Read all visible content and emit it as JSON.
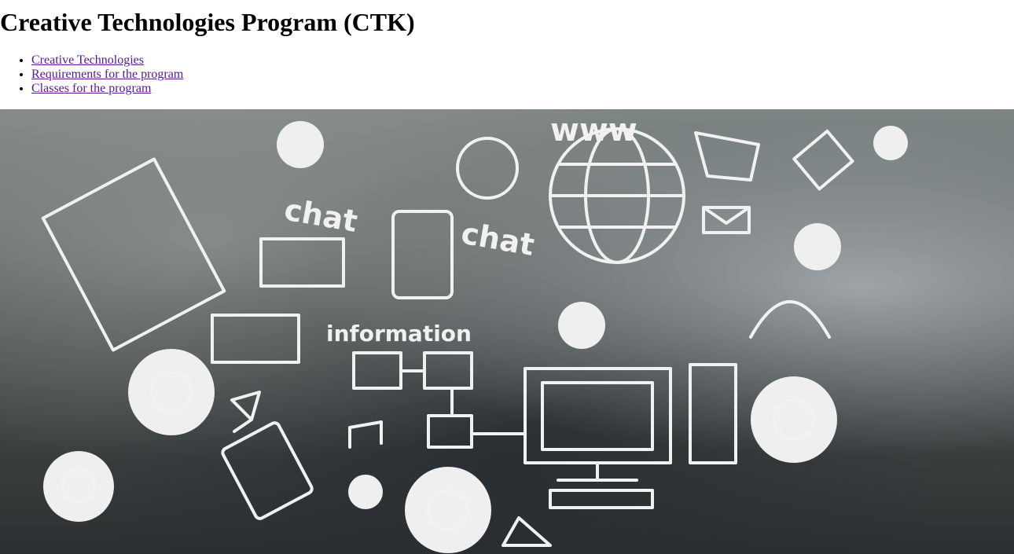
{
  "page": {
    "title": "Creative Technologies Program (CTK)"
  },
  "nav": {
    "items": [
      {
        "label": "Creative Technologies"
      },
      {
        "label": "Requirements for the program"
      },
      {
        "label": "Classes for the program"
      }
    ]
  },
  "image": {
    "labels": {
      "www": "www",
      "chat1": "chat",
      "chat2": "chat",
      "info": "information"
    }
  },
  "colors": {
    "link_visited": "#551A8B"
  }
}
